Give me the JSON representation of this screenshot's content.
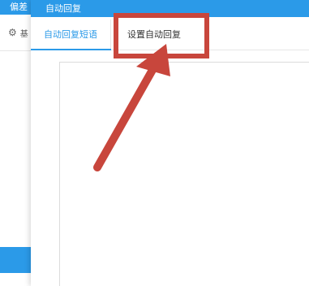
{
  "background_window": {
    "title": "偏差",
    "row_icon": "gear-icon",
    "row_text": "基"
  },
  "dialog": {
    "title": "自动回复",
    "tabs": [
      {
        "label": "自动回复短语",
        "active": true
      },
      {
        "label": "设置自动回复",
        "active": false
      }
    ]
  },
  "colors": {
    "accent": "#2b9ae8",
    "annotation": "#c8463c"
  },
  "annotation": {
    "shape": "arrow-pointing-to-box",
    "target": "设置自动回复"
  }
}
